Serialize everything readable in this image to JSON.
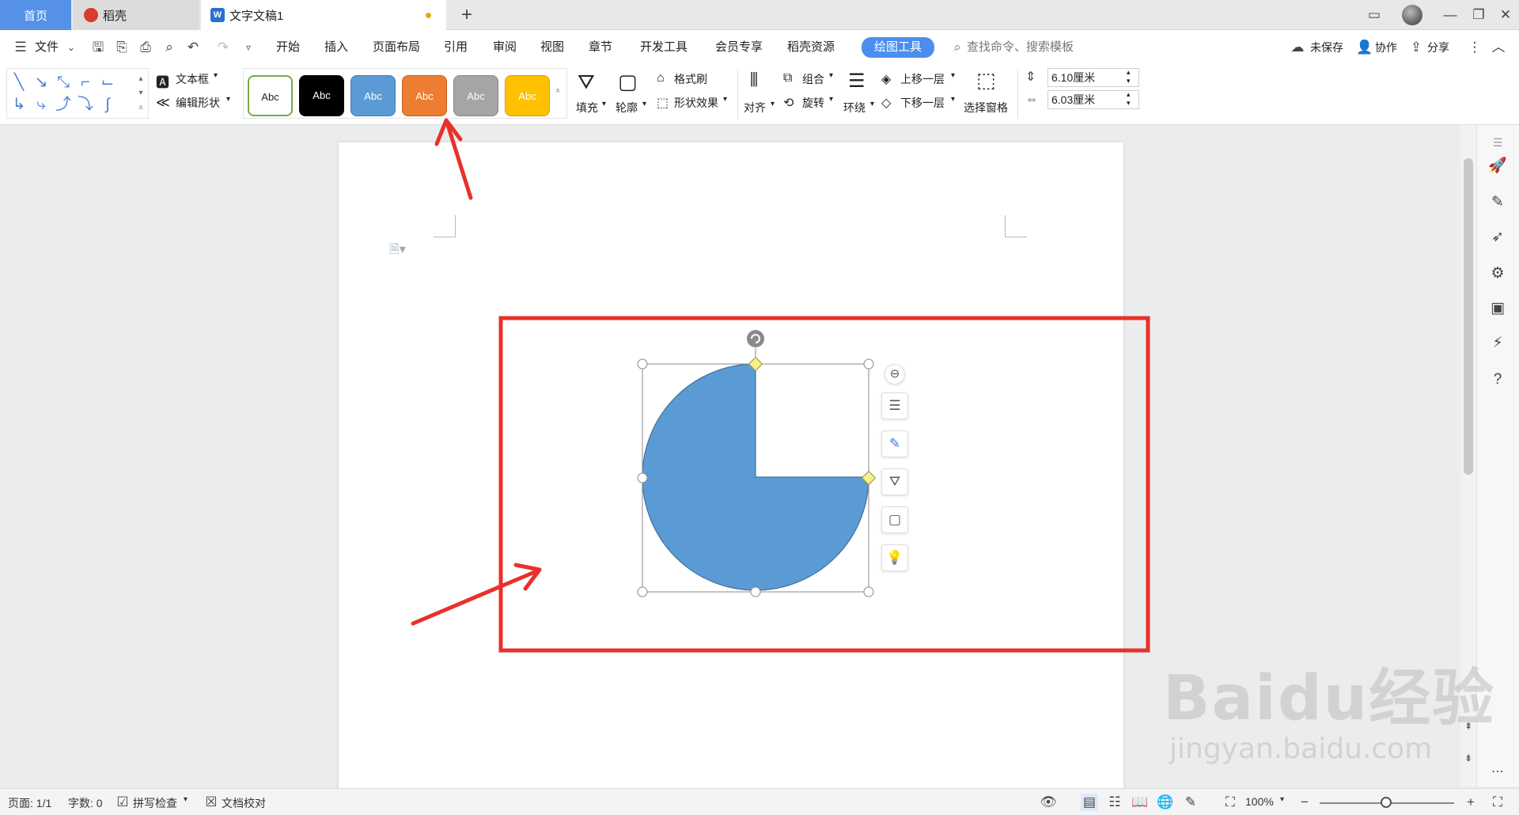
{
  "tabs": {
    "home": "首页",
    "docer": "稻壳",
    "document": "文字文稿1",
    "new_tab": "+"
  },
  "menu": {
    "file": "文件",
    "items": [
      "开始",
      "插入",
      "页面布局",
      "引用",
      "审阅",
      "视图",
      "章节",
      "开发工具",
      "会员专享",
      "稻壳资源"
    ],
    "active": "绘图工具",
    "search_placeholder": "查找命令、搜索模板",
    "unsaved": "未保存",
    "collaborate": "协作",
    "share": "分享"
  },
  "ribbon": {
    "textbox": "文本框",
    "edit_shape": "编辑形状",
    "style_labels": [
      "Abc",
      "Abc",
      "Abc",
      "Abc",
      "Abc",
      "Abc"
    ],
    "fill": "填充",
    "outline": "轮廓",
    "format_painter": "格式刷",
    "shape_effects": "形状效果",
    "align": "对齐",
    "group": "组合",
    "rotate": "旋转",
    "wrap": "环绕",
    "bring_forward": "上移一层",
    "send_backward": "下移一层",
    "selection_pane": "选择窗格",
    "height": "6.10厘米",
    "width": "6.03厘米"
  },
  "statusbar": {
    "page": "页面: 1/1",
    "word_count": "字数: 0",
    "spell_check": "拼写检查",
    "doc_check": "文档校对",
    "zoom": "100%"
  },
  "watermark": {
    "brand": "Baidu经验",
    "url": "jingyan.baidu.com"
  },
  "colors": {
    "tab_active": "#5591e7",
    "shape_fill": "#5b9bd5",
    "annotation": "#e8312a",
    "draw_tools_pill": "#4b8ef0",
    "style_orange": "#ed7d31",
    "style_gold": "#ffc000",
    "style_gray": "#a5a5a5"
  }
}
